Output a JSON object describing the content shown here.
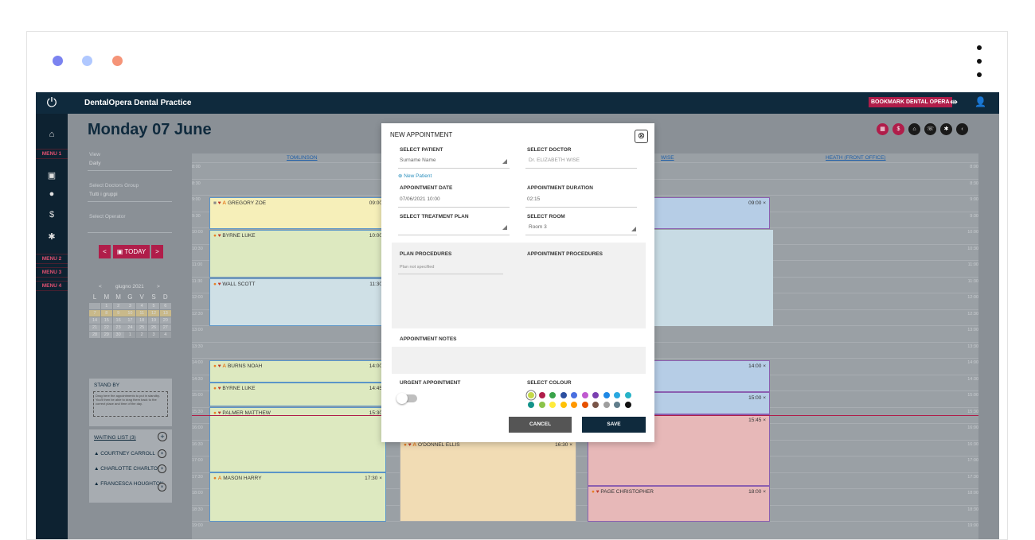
{
  "window": {
    "dot_colors": [
      "#7b83f0",
      "#b0c8ff",
      "#f59478"
    ]
  },
  "topbar": {
    "practice": "DentalOpera Dental Practice",
    "bookmark": "BOOKMARK DENTAL OPERA"
  },
  "sidebar": {
    "menus": [
      "MENU 1",
      "MENU 2",
      "MENU 3",
      "MENU 4"
    ]
  },
  "page": {
    "title": "Monday 07 June"
  },
  "filters": {
    "view_label": "View",
    "view_value": "Daily",
    "group_label": "Select Doctors Group",
    "group_value": "Tutti i gruppi",
    "operator_label": "Select Operator"
  },
  "nav": {
    "prev": "<",
    "today": "TODAY",
    "next": ">"
  },
  "mini_calendar": {
    "month": "giugno 2021",
    "weekdays": [
      "L",
      "M",
      "M",
      "G",
      "V",
      "S",
      "D"
    ],
    "weeks": [
      [
        "",
        "1",
        "2",
        "3",
        "4",
        "5",
        "6"
      ],
      [
        "7",
        "8",
        "9",
        "10",
        "11",
        "12",
        "13"
      ],
      [
        "14",
        "15",
        "16",
        "17",
        "18",
        "19",
        "20"
      ],
      [
        "21",
        "22",
        "23",
        "24",
        "25",
        "26",
        "27"
      ],
      [
        "28",
        "29",
        "30",
        "1",
        "2",
        "3",
        "4"
      ]
    ]
  },
  "standby": {
    "title": "STAND BY",
    "hint": "Drag here the appointments to put in standby. You'll then be able to drag them back to the correct place and time of the day."
  },
  "waiting": {
    "title": "WAITING LIST (3)",
    "items": [
      "COURTNEY CARROLL",
      "CHARLOTTE CHARLTON",
      "FRANCESCA HOUGHTON"
    ]
  },
  "columns": [
    "TOMLINSON",
    "WISE",
    "HEATH (FRONT OFFICE)"
  ],
  "times": [
    "8:00",
    "8:30",
    "9:00",
    "9:30",
    "10:00",
    "10:30",
    "11:00",
    "11:30",
    "12:00",
    "12:30",
    "13:00",
    "13:30",
    "14:00",
    "14:30",
    "15:00",
    "15:30",
    "16:00",
    "16:30",
    "17:00",
    "17:30",
    "18:00",
    "18:30",
    "19:00"
  ],
  "appointments": {
    "a1": {
      "name": "GREGORY ZOE",
      "time": "09:00"
    },
    "a2": {
      "name": "BYRNE LUKE",
      "time": "10:00"
    },
    "a3": {
      "name": "WALL SCOTT",
      "time": "11:30"
    },
    "a4": {
      "name": "BURNS NOAH",
      "time": "14:00"
    },
    "a5": {
      "name": "BYRNE LUKE",
      "time": "14:45"
    },
    "a6": {
      "name": "PALMER MATTHEW",
      "time": "15:30"
    },
    "a7": {
      "name": "MASON HARRY",
      "time": "17:30 ×"
    },
    "a8": {
      "name": "O'DONNEL ELLIS",
      "time": "16:30 ×"
    },
    "a9": {
      "name": "PAGE CHRISTOPHER",
      "time": "18:00 ×"
    },
    "w1": {
      "time": "09:00 ×"
    },
    "w2": {
      "time": "14:00 ×"
    },
    "w3": {
      "time": "15:00 ×"
    },
    "w4": {
      "time": "15:45 ×"
    }
  },
  "modal": {
    "title": "NEW APPOINTMENT",
    "patient_label": "SELECT PATIENT",
    "patient_value": "Surname Name",
    "new_patient": "New Patient",
    "doctor_label": "SELECT DOCTOR",
    "doctor_value": "Dr. ELIZABETH WISE",
    "date_label": "APPOINTMENT DATE",
    "date_value": "07/06/2021 10:00",
    "duration_label": "APPOINTMENT DURATION",
    "duration_value": "02:15",
    "plan_label": "SELECT TREATMENT PLAN",
    "room_label": "SELECT ROOM",
    "room_value": "Room 3",
    "plan_proc_label": "PLAN PROCEDURES",
    "plan_proc_value": "Plan not specified",
    "appt_proc_label": "APPOINTMENT PROCEDURES",
    "notes_label": "APPOINTMENT NOTES",
    "urgent_label": "URGENT APPOINTMENT",
    "colour_label": "SELECT COLOUR",
    "colours": [
      "#c5d94a",
      "#b01d4a",
      "#3aa34a",
      "#2c4fa0",
      "#4a6fe0",
      "#c05ad0",
      "#7a3fb0",
      "#1e88e5",
      "#29a8e0",
      "#27b3c7",
      "#13938a",
      "#8bc34a",
      "#ffeb3b",
      "#ffc107",
      "#ff9800",
      "#e65100",
      "#795548",
      "#9e9e9e",
      "#607d8b",
      "#111111"
    ],
    "cancel": "CANCEL",
    "save": "SAVE"
  }
}
